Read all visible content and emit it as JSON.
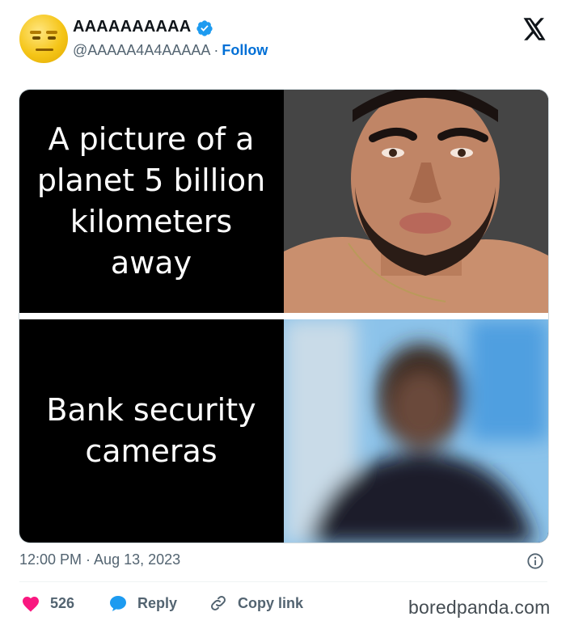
{
  "user": {
    "display_name": "AAAAAAAAAA",
    "handle": "@AAAAA4A4AAAAA",
    "separator": "·",
    "follow_label": "Follow"
  },
  "post": {
    "panels": [
      {
        "caption": "A picture of a planet 5 billion kilometers away"
      },
      {
        "caption": "Bank security cameras"
      }
    ],
    "timestamp": "12:00 PM · Aug 13, 2023"
  },
  "actions": {
    "like_count": "526",
    "reply_label": "Reply",
    "copy_link_label": "Copy link"
  },
  "watermark": "boredpanda.com",
  "colors": {
    "like": "#f91880",
    "reply": "#1d9bf0",
    "follow": "#006fd6",
    "verified": "#1d9bf0"
  },
  "icons": [
    "avatar-emoji",
    "verified-badge-icon",
    "x-logo-icon",
    "info-icon",
    "heart-icon",
    "reply-bubble-icon",
    "link-icon"
  ]
}
